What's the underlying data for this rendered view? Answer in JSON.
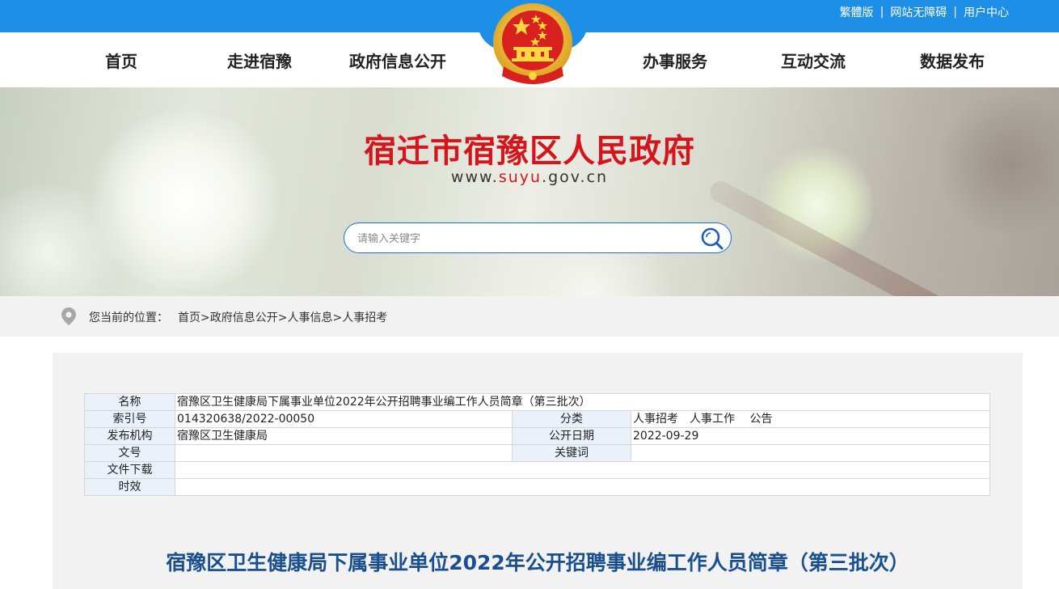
{
  "top_links": [
    "繁體版",
    "网站无障碍",
    "用户中心"
  ],
  "top_separator": "|",
  "nav": {
    "left": [
      "首页",
      "走进宿豫",
      "政府信息公开"
    ],
    "right": [
      "办事服务",
      "互动交流",
      "数据发布"
    ]
  },
  "banner": {
    "site_title": "宿迁市宿豫区人民政府",
    "url_prefix": "www.",
    "url_highlight": "suyu",
    "url_suffix": ".gov.cn"
  },
  "search": {
    "placeholder": "请输入关键字"
  },
  "breadcrumb": {
    "label": "您当前的位置：",
    "items": [
      "首页",
      "政府信息公开",
      "人事信息",
      "人事招考"
    ],
    "separator": ">"
  },
  "meta": {
    "name_label": "名称",
    "name_value": "宿豫区卫生健康局下属事业单位2022年公开招聘事业编工作人员简章（第三批次）",
    "index_label": "索引号",
    "index_value": "014320638/2022-00050",
    "category_label": "分类",
    "category_value": "人事招考　人事工作　 公告",
    "publisher_label": "发布机构",
    "publisher_value": "宿豫区卫生健康局",
    "date_label": "公开日期",
    "date_value": "2022-09-29",
    "docno_label": "文号",
    "docno_value": "",
    "keywords_label": "关键词",
    "keywords_value": "",
    "download_label": "文件下载",
    "download_value": "",
    "validity_label": "时效",
    "validity_value": ""
  },
  "article": {
    "title": "宿豫区卫生健康局下属事业单位2022年公开招聘事业编工作人员简章（第三批次）"
  },
  "colors": {
    "topbar": "#1e8fe6",
    "title_red": "#d4151b",
    "article_title": "#1a4f8f"
  }
}
